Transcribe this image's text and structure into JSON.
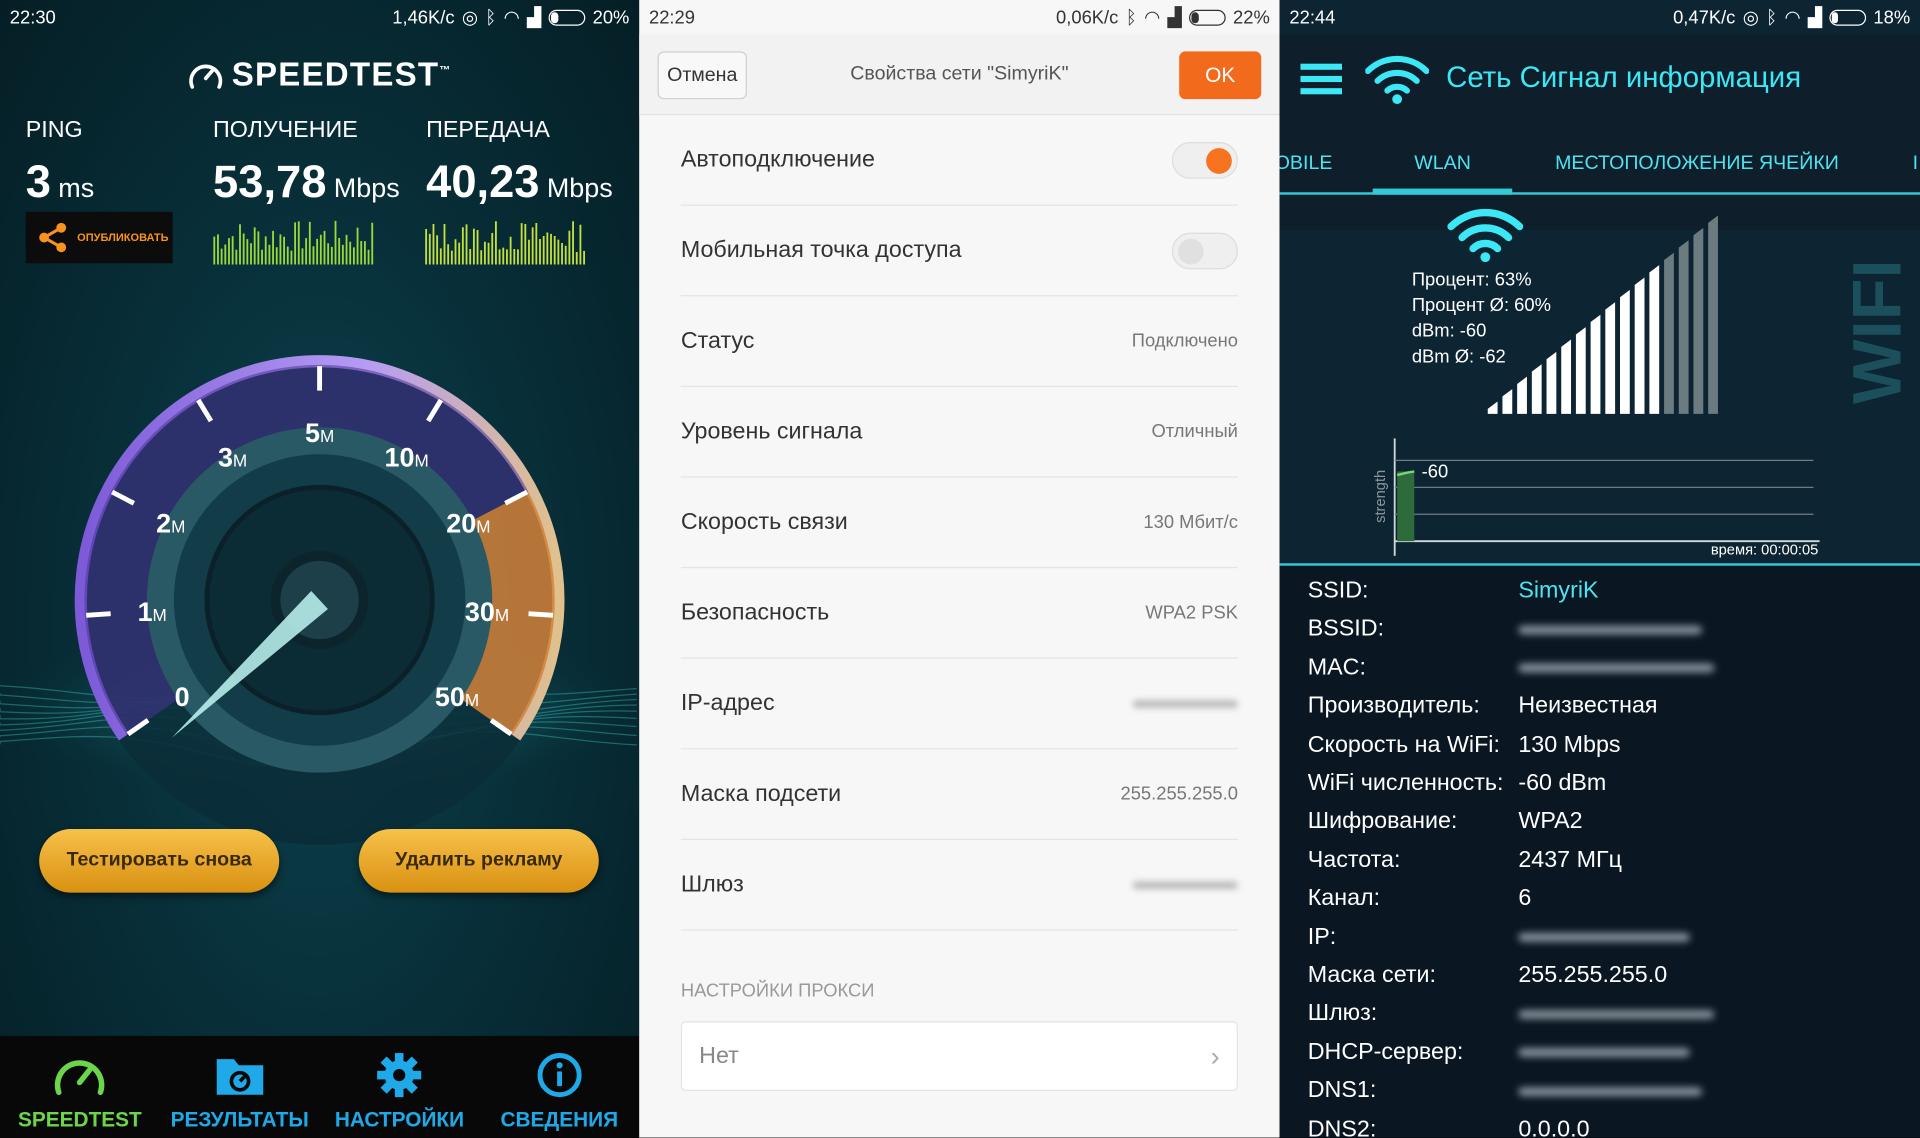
{
  "speedtest": {
    "status": {
      "time": "22:30",
      "speed": "1,46K/c",
      "battery": "20%",
      "battery_level": 0.2
    },
    "logo": "SPEEDTEST",
    "logo_tm": "™",
    "ping": {
      "label": "PING",
      "value": "3",
      "unit": "ms"
    },
    "download": {
      "label": "ПОЛУЧЕНИЕ",
      "value": "53,78",
      "unit": "Mbps"
    },
    "upload": {
      "label": "ПЕРЕДАЧА",
      "value": "40,23",
      "unit": "Mbps"
    },
    "publish_label": "ОПУБЛИКОВАТЬ",
    "gauge_labels": [
      {
        "num": "0",
        "unit": "",
        "value": 0
      },
      {
        "num": "1",
        "unit": "M",
        "value": 1
      },
      {
        "num": "2",
        "unit": "M",
        "value": 2
      },
      {
        "num": "3",
        "unit": "M",
        "value": 3
      },
      {
        "num": "5",
        "unit": "M",
        "value": 5
      },
      {
        "num": "10",
        "unit": "M",
        "value": 10
      },
      {
        "num": "20",
        "unit": "M",
        "value": 20
      },
      {
        "num": "30",
        "unit": "M",
        "value": 30
      },
      {
        "num": "50",
        "unit": "M",
        "value": 50
      }
    ],
    "retest_button": "Тестировать снова",
    "remove_ads_button": "Удалить рекламу",
    "nav": [
      {
        "label": "SPEEDTEST",
        "icon": "speedometer-icon",
        "active": true
      },
      {
        "label": "РЕЗУЛЬТАТЫ",
        "icon": "folder-gauge-icon",
        "active": false
      },
      {
        "label": "НАСТРОЙКИ",
        "icon": "gear-icon",
        "active": false
      },
      {
        "label": "СВЕДЕНИЯ",
        "icon": "info-icon",
        "active": false
      }
    ],
    "colors": {
      "download_spark": "#9bd83a",
      "upload_spark": "#c4e03c",
      "accent_orange": "#d98a2f",
      "nav_active": "#6bd64a",
      "nav_inactive": "#1fa9e8"
    }
  },
  "network": {
    "status": {
      "time": "22:29",
      "speed": "0,06K/c",
      "battery": "22%",
      "battery_level": 0.22
    },
    "cancel": "Отмена",
    "title": "Свойства сети \"SimyriK\"",
    "ok": "OK",
    "rows": [
      {
        "key": "Автоподключение",
        "type": "toggle",
        "on": true
      },
      {
        "key": "Мобильная точка доступа",
        "type": "toggle",
        "on": false
      },
      {
        "key": "Статус",
        "type": "text",
        "value": "Подключено"
      },
      {
        "key": "Уровень сигнала",
        "type": "text",
        "value": "Отличный"
      },
      {
        "key": "Скорость связи",
        "type": "text",
        "value": "130 Мбит/с"
      },
      {
        "key": "Безопасность",
        "type": "text",
        "value": "WPA2 PSK"
      },
      {
        "key": "IP-адрес",
        "type": "hidden"
      },
      {
        "key": "Маска подсети",
        "type": "text",
        "value": "255.255.255.0"
      },
      {
        "key": "Шлюз",
        "type": "hidden"
      }
    ],
    "proxy_section": "НАСТРОЙКИ ПРОКСИ",
    "proxy_value": "Нет",
    "colors": {
      "ok_button": "#f26b1d",
      "toggle_on": "#f7731f"
    }
  },
  "signal": {
    "status": {
      "time": "22:44",
      "speed": "0,47K/c",
      "battery": "18%",
      "battery_level": 0.18
    },
    "title": "Сеть Сигнал информация",
    "tabs": [
      "OBILE",
      "WLAN",
      "МЕСТОПОЛОЖЕНИЕ ЯЧЕЙКИ",
      "I"
    ],
    "active_tab": "WLAN",
    "stats": [
      "Процент: 63%",
      "Процент Ø: 60%",
      "dBm: -60",
      "dBm Ø: -62"
    ],
    "signal_bars_lit": 12,
    "signal_bars_total": 16,
    "graph": {
      "ylabel": "strength",
      "value_label": "-60",
      "time_label": "время: 00:00:05"
    },
    "side_text": "WIFI",
    "info": [
      {
        "key": "SSID:",
        "value": "SimyriK",
        "hidden": false
      },
      {
        "key": "BSSID:",
        "value": "",
        "hidden": true
      },
      {
        "key": "MAC:",
        "value": "",
        "hidden": true
      },
      {
        "key": "Производитель:",
        "value": "Неизвестная",
        "hidden": false
      },
      {
        "key": "Скорость на WiFi:",
        "value": "130 Mbps",
        "hidden": false
      },
      {
        "key": "WiFi численность:",
        "value": "-60 dBm",
        "hidden": false
      },
      {
        "key": "Шифрование:",
        "value": "WPA2",
        "hidden": false
      },
      {
        "key": "Частота:",
        "value": "2437 МГц",
        "hidden": false
      },
      {
        "key": "Канал:",
        "value": "6",
        "hidden": false
      },
      {
        "key": "IP:",
        "value": "",
        "hidden": true
      },
      {
        "key": "Маска сети:",
        "value": "255.255.255.0",
        "hidden": false
      },
      {
        "key": "Шлюз:",
        "value": "",
        "hidden": true
      },
      {
        "key": "DHCP-сервер:",
        "value": "",
        "hidden": true
      },
      {
        "key": "DNS1:",
        "value": "",
        "hidden": true
      },
      {
        "key": "DNS2:",
        "value": "0.0.0.0",
        "hidden": false
      }
    ],
    "colors": {
      "accent": "#33c9d6",
      "title": "#3ce8f5"
    }
  }
}
